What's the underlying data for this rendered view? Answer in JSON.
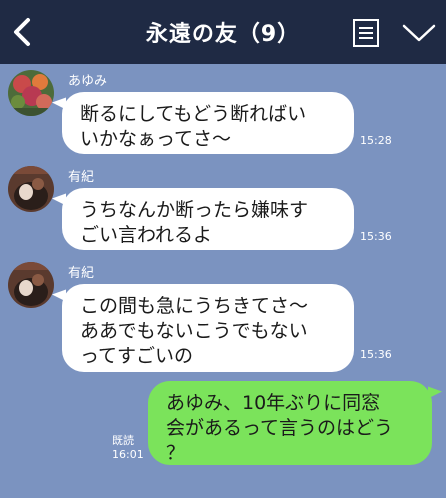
{
  "header": {
    "title": "永遠の友（9）",
    "back_icon": "back-chevron-icon",
    "menu_icon": "notes-icon",
    "expand_icon": "chevron-down-icon",
    "background": "#1f2a44"
  },
  "chat": {
    "background": "#7b93c0",
    "messages": [
      {
        "sender": "あゆみ",
        "lines": [
          "断るにしてもどう断ればい",
          "いかなぁってさ〜"
        ],
        "time": "15:28"
      },
      {
        "sender": "有紀",
        "lines": [
          "うちなんか断ったら嫌味す",
          "ごい言われるよ"
        ],
        "time": "15:36"
      },
      {
        "sender": "有紀",
        "lines": [
          "この間も急にうちきてさ〜",
          "ああでもないこうでもない",
          "ってすごいの"
        ],
        "time": "15:36"
      },
      {
        "lines": [
          "あゆみ、10年ぶりに同窓",
          "会があるって言うのはどう",
          "？"
        ],
        "read": "既読",
        "time": "16:01",
        "color": "#7be35b"
      }
    ]
  }
}
